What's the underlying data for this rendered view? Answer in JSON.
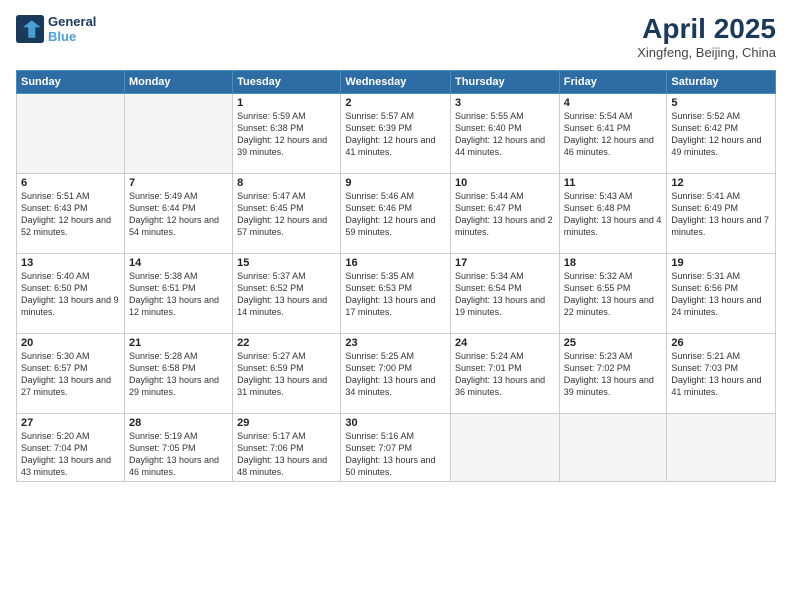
{
  "header": {
    "logo_line1": "General",
    "logo_line2": "Blue",
    "title": "April 2025",
    "location": "Xingfeng, Beijing, China"
  },
  "weekdays": [
    "Sunday",
    "Monday",
    "Tuesday",
    "Wednesday",
    "Thursday",
    "Friday",
    "Saturday"
  ],
  "weeks": [
    [
      {
        "day": "",
        "info": ""
      },
      {
        "day": "",
        "info": ""
      },
      {
        "day": "1",
        "info": "Sunrise: 5:59 AM\nSunset: 6:38 PM\nDaylight: 12 hours and 39 minutes."
      },
      {
        "day": "2",
        "info": "Sunrise: 5:57 AM\nSunset: 6:39 PM\nDaylight: 12 hours and 41 minutes."
      },
      {
        "day": "3",
        "info": "Sunrise: 5:55 AM\nSunset: 6:40 PM\nDaylight: 12 hours and 44 minutes."
      },
      {
        "day": "4",
        "info": "Sunrise: 5:54 AM\nSunset: 6:41 PM\nDaylight: 12 hours and 46 minutes."
      },
      {
        "day": "5",
        "info": "Sunrise: 5:52 AM\nSunset: 6:42 PM\nDaylight: 12 hours and 49 minutes."
      }
    ],
    [
      {
        "day": "6",
        "info": "Sunrise: 5:51 AM\nSunset: 6:43 PM\nDaylight: 12 hours and 52 minutes."
      },
      {
        "day": "7",
        "info": "Sunrise: 5:49 AM\nSunset: 6:44 PM\nDaylight: 12 hours and 54 minutes."
      },
      {
        "day": "8",
        "info": "Sunrise: 5:47 AM\nSunset: 6:45 PM\nDaylight: 12 hours and 57 minutes."
      },
      {
        "day": "9",
        "info": "Sunrise: 5:46 AM\nSunset: 6:46 PM\nDaylight: 12 hours and 59 minutes."
      },
      {
        "day": "10",
        "info": "Sunrise: 5:44 AM\nSunset: 6:47 PM\nDaylight: 13 hours and 2 minutes."
      },
      {
        "day": "11",
        "info": "Sunrise: 5:43 AM\nSunset: 6:48 PM\nDaylight: 13 hours and 4 minutes."
      },
      {
        "day": "12",
        "info": "Sunrise: 5:41 AM\nSunset: 6:49 PM\nDaylight: 13 hours and 7 minutes."
      }
    ],
    [
      {
        "day": "13",
        "info": "Sunrise: 5:40 AM\nSunset: 6:50 PM\nDaylight: 13 hours and 9 minutes."
      },
      {
        "day": "14",
        "info": "Sunrise: 5:38 AM\nSunset: 6:51 PM\nDaylight: 13 hours and 12 minutes."
      },
      {
        "day": "15",
        "info": "Sunrise: 5:37 AM\nSunset: 6:52 PM\nDaylight: 13 hours and 14 minutes."
      },
      {
        "day": "16",
        "info": "Sunrise: 5:35 AM\nSunset: 6:53 PM\nDaylight: 13 hours and 17 minutes."
      },
      {
        "day": "17",
        "info": "Sunrise: 5:34 AM\nSunset: 6:54 PM\nDaylight: 13 hours and 19 minutes."
      },
      {
        "day": "18",
        "info": "Sunrise: 5:32 AM\nSunset: 6:55 PM\nDaylight: 13 hours and 22 minutes."
      },
      {
        "day": "19",
        "info": "Sunrise: 5:31 AM\nSunset: 6:56 PM\nDaylight: 13 hours and 24 minutes."
      }
    ],
    [
      {
        "day": "20",
        "info": "Sunrise: 5:30 AM\nSunset: 6:57 PM\nDaylight: 13 hours and 27 minutes."
      },
      {
        "day": "21",
        "info": "Sunrise: 5:28 AM\nSunset: 6:58 PM\nDaylight: 13 hours and 29 minutes."
      },
      {
        "day": "22",
        "info": "Sunrise: 5:27 AM\nSunset: 6:59 PM\nDaylight: 13 hours and 31 minutes."
      },
      {
        "day": "23",
        "info": "Sunrise: 5:25 AM\nSunset: 7:00 PM\nDaylight: 13 hours and 34 minutes."
      },
      {
        "day": "24",
        "info": "Sunrise: 5:24 AM\nSunset: 7:01 PM\nDaylight: 13 hours and 36 minutes."
      },
      {
        "day": "25",
        "info": "Sunrise: 5:23 AM\nSunset: 7:02 PM\nDaylight: 13 hours and 39 minutes."
      },
      {
        "day": "26",
        "info": "Sunrise: 5:21 AM\nSunset: 7:03 PM\nDaylight: 13 hours and 41 minutes."
      }
    ],
    [
      {
        "day": "27",
        "info": "Sunrise: 5:20 AM\nSunset: 7:04 PM\nDaylight: 13 hours and 43 minutes."
      },
      {
        "day": "28",
        "info": "Sunrise: 5:19 AM\nSunset: 7:05 PM\nDaylight: 13 hours and 46 minutes."
      },
      {
        "day": "29",
        "info": "Sunrise: 5:17 AM\nSunset: 7:06 PM\nDaylight: 13 hours and 48 minutes."
      },
      {
        "day": "30",
        "info": "Sunrise: 5:16 AM\nSunset: 7:07 PM\nDaylight: 13 hours and 50 minutes."
      },
      {
        "day": "",
        "info": ""
      },
      {
        "day": "",
        "info": ""
      },
      {
        "day": "",
        "info": ""
      }
    ]
  ]
}
